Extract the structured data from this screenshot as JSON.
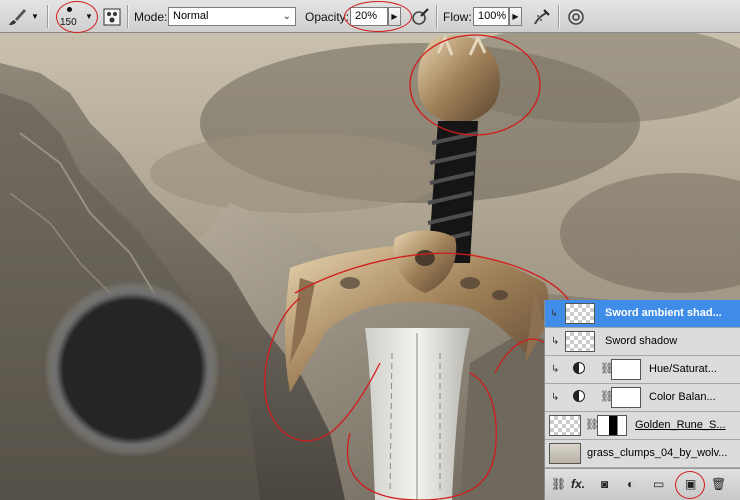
{
  "toolbar": {
    "brush_size": "150",
    "mode_label": "Mode:",
    "mode_value": "Normal",
    "opacity_label": "Opacity:",
    "opacity_value": "20%",
    "flow_label": "Flow:",
    "flow_value": "100%"
  },
  "layers": {
    "items": [
      {
        "name": "Sword ambient shad...",
        "selected": true
      },
      {
        "name": "Sword shadow",
        "selected": false
      },
      {
        "name": "Hue/Saturat...",
        "selected": false
      },
      {
        "name": "Color Balan...",
        "selected": false
      },
      {
        "name": "Golden_Rune_S...",
        "selected": false
      },
      {
        "name": "grass_clumps_04_by_wolv...",
        "selected": false
      }
    ],
    "footer": {
      "fx_label": "fx."
    }
  },
  "colors": {
    "selected_layer": "#3f8de8",
    "annotation_red": "#d21c1c",
    "brush_preview": "#232526"
  },
  "icons": {
    "tool": "brush-icon",
    "brush_panel": "brush-panel-icon",
    "airbrush": "airbrush-icon",
    "pressure": "pressure-icon"
  }
}
